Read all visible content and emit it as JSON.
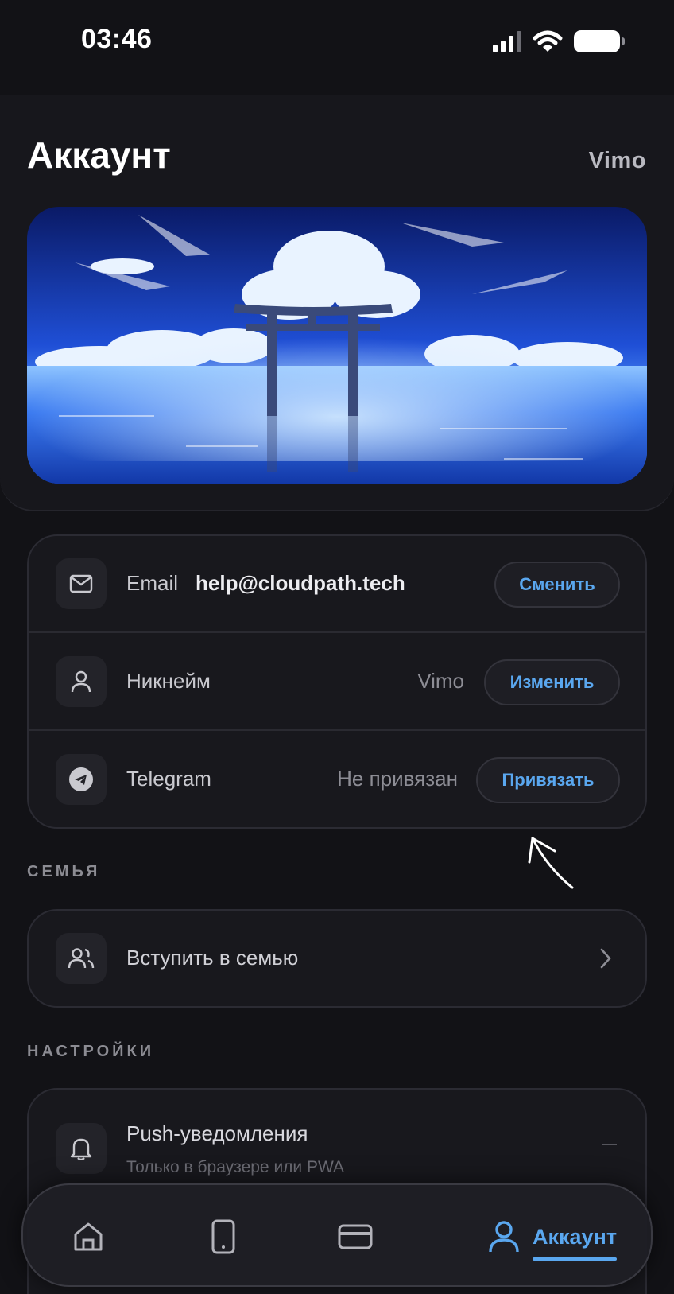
{
  "status_bar": {
    "time": "03:46"
  },
  "header": {
    "title": "Аккаунт",
    "username": "Vimo"
  },
  "account": {
    "email": {
      "label": "Email",
      "value": "help@cloudpath.tech",
      "button": "Сменить",
      "icon": "mail-icon"
    },
    "nickname": {
      "label": "Никнейм",
      "value": "Vimo",
      "button": "Изменить",
      "icon": "user-icon"
    },
    "telegram": {
      "label": "Telegram",
      "value": "Не привязан",
      "button": "Привязать",
      "icon": "telegram-icon"
    }
  },
  "family": {
    "section_label": "СЕМЬЯ",
    "join_label": "Вступить в семью",
    "icon": "users-icon"
  },
  "settings": {
    "section_label": "НАСТРОЙКИ",
    "push": {
      "title": "Push-уведомления",
      "subtitle": "Только в браузере или PWA",
      "icon": "bell-icon"
    }
  },
  "nav": {
    "items": [
      {
        "icon": "home-icon"
      },
      {
        "icon": "phone-icon"
      },
      {
        "icon": "card-icon"
      },
      {
        "icon": "user-icon",
        "label": "Аккаунт",
        "active": true
      }
    ]
  },
  "colors": {
    "accent": "#5aa7ef",
    "background": "#121216",
    "card": "#18181d"
  }
}
